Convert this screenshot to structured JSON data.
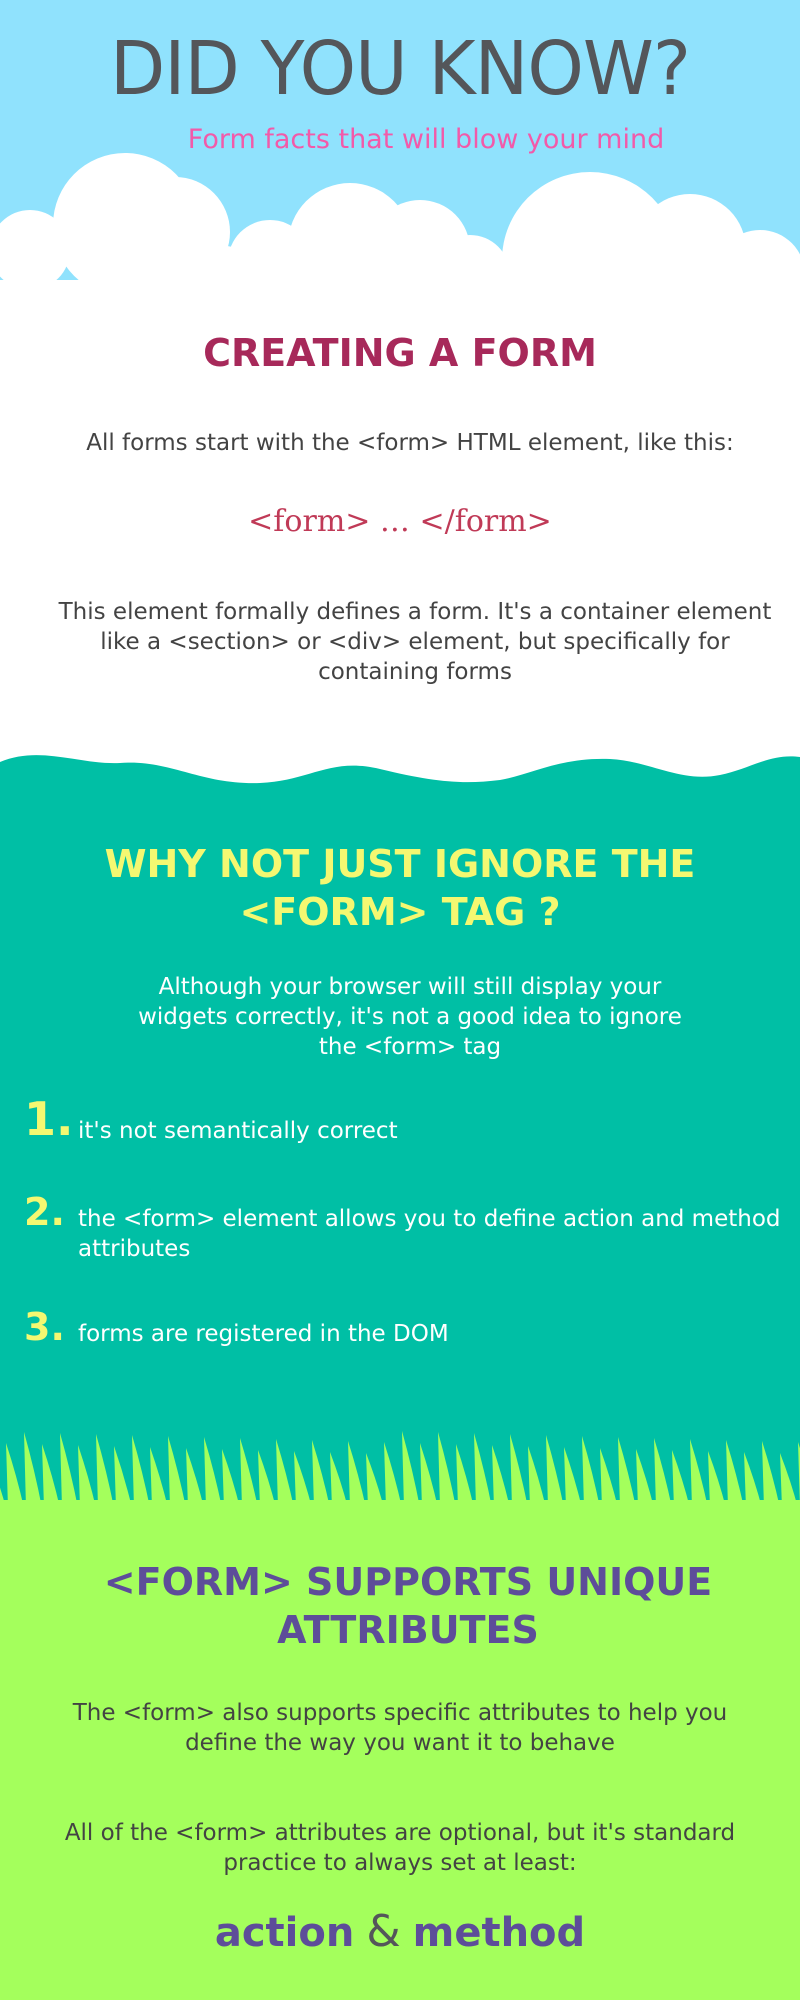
{
  "header": {
    "title": "DID YOU KNOW?",
    "subtitle": "Form facts that will blow your mind"
  },
  "creating": {
    "heading": "CREATING A FORM",
    "intro": "All forms start with the <form> HTML element, like this:",
    "code": "<form> … </form>",
    "description": "This element formally defines a form. It's a container element like a <section> or <div> element, but specifically for containing forms"
  },
  "why": {
    "heading_line1": "WHY NOT JUST IGNORE THE",
    "heading_line2": "<FORM> TAG ?",
    "intro": "Although your browser will still display your widgets correctly, it's not a good idea to ignore the <form> tag",
    "reasons": [
      {
        "number": "1.",
        "text": "it's not semantically correct"
      },
      {
        "number": "2.",
        "text": "the <form> element allows you to define action and method attributes"
      },
      {
        "number": "3.",
        "text": "forms are registered in the DOM"
      }
    ]
  },
  "attributes": {
    "heading_line1": "<FORM> SUPPORTS UNIQUE",
    "heading_line2": "ATTRIBUTES",
    "intro": "The <form> also supports specific attributes to help you define the way you want it to behave",
    "note": "All of the <form> attributes are optional, but it's standard practice to always set at least:",
    "attr1": "action",
    "amp": "&",
    "attr2": "method"
  },
  "colors": {
    "sky": "#90e2fd",
    "title": "#54565a",
    "subtitle": "#f25aa9",
    "heading_red": "#a7295a",
    "code_red": "#c03a57",
    "teal": "#00bfa5",
    "yellow": "#f4f871",
    "green": "#a4ff5c",
    "purple": "#5d4d99"
  }
}
